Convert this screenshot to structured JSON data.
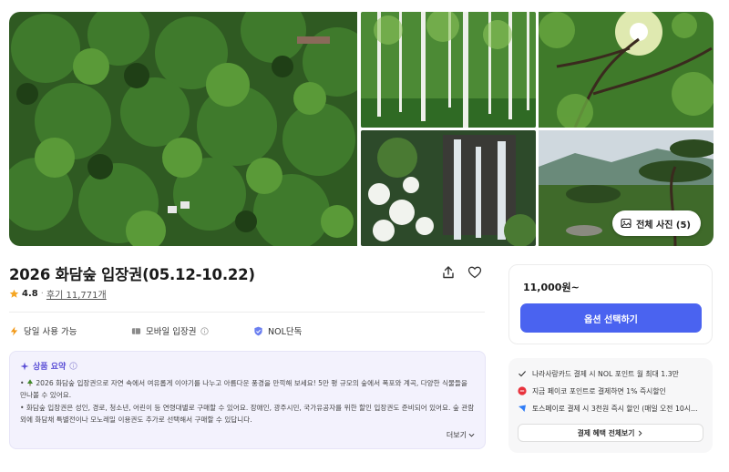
{
  "product": {
    "title": "2026 화담숲 입장권(05.12-10.22)",
    "rating": "4.8",
    "rating_separator": "·",
    "reviews": "후기 11,771개"
  },
  "gallery": {
    "all_photos_label": "전체 사진 (5)"
  },
  "features": [
    {
      "label": "당일 사용 가능",
      "icon": "lightning-icon"
    },
    {
      "label": "모바일 입장권",
      "icon": "ticket-icon"
    },
    {
      "label": "NOL단독",
      "icon": "shield-check-icon"
    }
  ],
  "summary": {
    "title": "상품 요약",
    "line1": "2026 화담숲 입장권으로 자연 속에서 여유롭게 이야기를 나누고 아름다운 풍경을 만끽해 보세요! 5만 평 규모의 숲에서 폭포와 계곡, 다양한 식물들을 만나볼 수 있어요.",
    "line2": "화담숲 입장권은 성인, 경로, 청소년, 어린이 등 연령대별로 구매할 수 있어요. 장애인, 광주시민, 국가유공자를 위한 할인 입장권도 준비되어 있어요. 숲 관람 외에 화담채 특별전이나 모노레일 이용권도 추가로 선택해서 구매할 수 있답니다.",
    "more_label": "더보기"
  },
  "pricing": {
    "price": "11,000원~",
    "option_button": "옵션 선택하기"
  },
  "benefits": {
    "items": [
      {
        "text": "나라사랑카드 결제 시 NOL 포인트 월 최대 1.3만",
        "icon": "check-icon"
      },
      {
        "text": "지금 페이코 포인트로 결제하면 1% 즉시할인",
        "icon": "payco-icon"
      },
      {
        "text": "토스페이로 결제 시 3천원 즉시 할인 (매일 오전 10시...",
        "icon": "toss-icon"
      }
    ],
    "view_all_label": "결제 혜택 전체보기"
  },
  "colors": {
    "accent": "#4a63f0",
    "summary_bg": "#f3f2fd",
    "summary_accent": "#5b4fd6",
    "star": "#f5a623"
  }
}
